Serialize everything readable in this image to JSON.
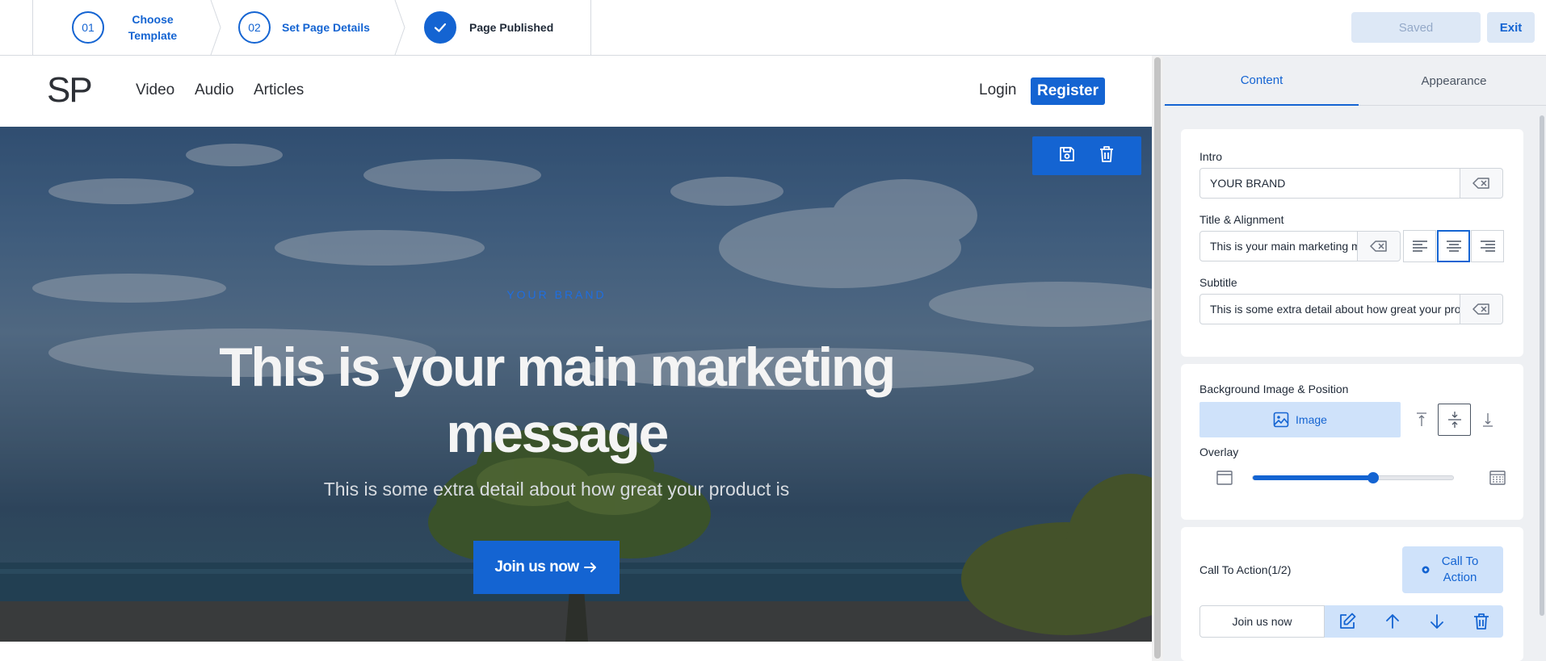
{
  "stepper": {
    "steps": [
      {
        "number": "01",
        "label": "Choose Template"
      },
      {
        "number": "02",
        "label": "Set Page Details"
      },
      {
        "number": "",
        "label": "Page Published"
      }
    ]
  },
  "toolbar": {
    "saved_label": "Saved",
    "exit_label": "Exit"
  },
  "site": {
    "logo": "SP",
    "nav": [
      "Video",
      "Audio",
      "Articles"
    ],
    "login_label": "Login",
    "register_label": "Register"
  },
  "hero": {
    "intro": "YOUR BRAND",
    "title": "This is your main marketing message",
    "subtitle": "This is some extra detail about how great your product is",
    "cta_label": "Join us now"
  },
  "panel": {
    "tabs": [
      "Content",
      "Appearance"
    ],
    "active_tab": "Content",
    "intro": {
      "label": "Intro",
      "value": "YOUR BRAND"
    },
    "title": {
      "label": "Title & Alignment",
      "value": "This is your main marketing message",
      "alignment": "center"
    },
    "subtitle": {
      "label": "Subtitle",
      "value": "This is some extra detail about how great your product is"
    },
    "background": {
      "label": "Background Image & Position",
      "image_button": "Image",
      "position": "middle"
    },
    "overlay": {
      "label": "Overlay",
      "value": 0.6
    },
    "cta": {
      "label": "Call To Action(1/2)",
      "add_button": "Call To Action",
      "item_label": "Join us now"
    }
  },
  "colors": {
    "accent": "#1464d2",
    "accent_light": "#cfe2fa",
    "panel_bg": "#eef0f3"
  }
}
